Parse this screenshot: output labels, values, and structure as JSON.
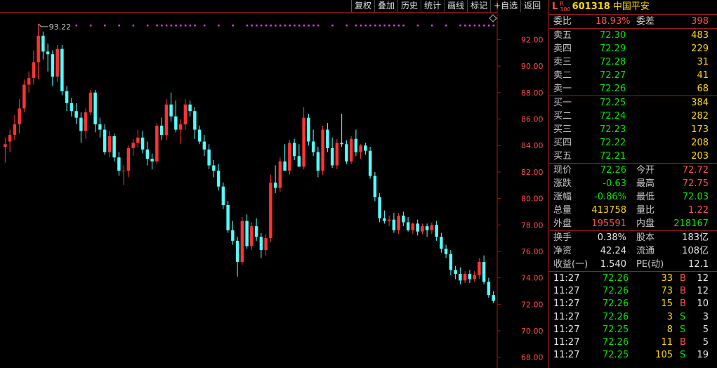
{
  "toolbar": [
    "复权",
    "叠加",
    "历史",
    "统计",
    "画线",
    "标记",
    "+自选",
    "返回"
  ],
  "header": {
    "prefix": "L",
    "r_top": "R",
    "r_bottom": "300",
    "code": "601318",
    "name": "中国平安"
  },
  "chart_data": {
    "type": "candlestick",
    "y_ticks": [
      "92.00",
      "90.00",
      "88.00",
      "86.00",
      "84.00",
      "82.00",
      "80.00",
      "78.00",
      "76.00",
      "74.00",
      "72.00",
      "70.00",
      "68.00"
    ],
    "ylim": [
      67.4,
      94.2
    ],
    "annotation": "93.22",
    "up_color": "#ff3333",
    "down_color": "#54ffff",
    "marker_color": "#ff33ff",
    "candles": [
      [
        83.9,
        84.6,
        82.7,
        84.1
      ],
      [
        84.3,
        85.2,
        83.5,
        84.8
      ],
      [
        84.8,
        86.3,
        84.4,
        85.6
      ],
      [
        85.6,
        87.5,
        84.9,
        86.8
      ],
      [
        86.8,
        89.0,
        86.5,
        88.6
      ],
      [
        88.6,
        89.6,
        88.0,
        89.1
      ],
      [
        89.1,
        91.2,
        88.6,
        90.3
      ],
      [
        90.3,
        93.2,
        89.0,
        92.3
      ],
      [
        92.3,
        92.6,
        90.5,
        91.1
      ],
      [
        91.1,
        91.7,
        89.6,
        90.9
      ],
      [
        90.9,
        91.2,
        88.5,
        89.2
      ],
      [
        89.2,
        91.6,
        88.8,
        91.3
      ],
      [
        91.3,
        91.6,
        87.8,
        88.1
      ],
      [
        88.1,
        88.5,
        86.6,
        87.2
      ],
      [
        87.2,
        87.6,
        86.2,
        86.6
      ],
      [
        86.6,
        87.2,
        85.6,
        86.1
      ],
      [
        86.1,
        86.5,
        84.2,
        85.1
      ],
      [
        85.1,
        86.8,
        84.5,
        86.5
      ],
      [
        86.5,
        88.2,
        86.3,
        88.0
      ],
      [
        88.0,
        88.2,
        85.0,
        85.6
      ],
      [
        85.6,
        86.1,
        84.6,
        85.2
      ],
      [
        85.2,
        85.6,
        83.3,
        83.5
      ],
      [
        83.5,
        85.1,
        83.1,
        84.7
      ],
      [
        84.7,
        84.9,
        82.8,
        83.1
      ],
      [
        83.1,
        83.5,
        81.7,
        82.1
      ],
      [
        82.1,
        82.5,
        81.0,
        82.1
      ],
      [
        82.1,
        84.0,
        81.6,
        83.8
      ],
      [
        83.8,
        84.5,
        83.2,
        84.2
      ],
      [
        84.2,
        85.2,
        83.8,
        84.6
      ],
      [
        84.6,
        85.1,
        83.4,
        83.7
      ],
      [
        83.7,
        84.3,
        82.5,
        83.0
      ],
      [
        83.0,
        83.4,
        82.2,
        82.8
      ],
      [
        82.8,
        85.7,
        82.6,
        85.5
      ],
      [
        85.5,
        86.1,
        84.4,
        84.8
      ],
      [
        84.8,
        87.5,
        84.4,
        87.1
      ],
      [
        87.1,
        88.0,
        85.8,
        86.2
      ],
      [
        86.2,
        87.4,
        85.0,
        85.2
      ],
      [
        85.2,
        86.0,
        84.1,
        85.6
      ],
      [
        85.6,
        87.5,
        85.2,
        87.1
      ],
      [
        87.1,
        87.4,
        86.2,
        86.6
      ],
      [
        86.6,
        86.9,
        84.5,
        85.2
      ],
      [
        85.2,
        85.5,
        84.1,
        84.3
      ],
      [
        84.3,
        84.8,
        83.2,
        83.7
      ],
      [
        83.7,
        84.1,
        82.2,
        82.5
      ],
      [
        82.5,
        82.9,
        81.6,
        82.1
      ],
      [
        82.1,
        82.6,
        80.6,
        80.9
      ],
      [
        80.9,
        81.2,
        79.2,
        79.5
      ],
      [
        79.5,
        79.8,
        77.4,
        77.6
      ],
      [
        77.6,
        78.3,
        76.5,
        76.8
      ],
      [
        76.8,
        77.1,
        74.1,
        75.2
      ],
      [
        75.2,
        78.6,
        75.0,
        78.3
      ],
      [
        78.3,
        78.8,
        76.2,
        76.4
      ],
      [
        76.4,
        78.2,
        76.1,
        77.9
      ],
      [
        77.9,
        78.5,
        76.8,
        77.1
      ],
      [
        77.1,
        77.4,
        75.5,
        76.1
      ],
      [
        76.1,
        77.3,
        75.7,
        77.0
      ],
      [
        77.0,
        81.8,
        76.7,
        81.2
      ],
      [
        81.2,
        82.5,
        80.4,
        80.8
      ],
      [
        80.8,
        83.1,
        80.5,
        82.8
      ],
      [
        82.8,
        84.1,
        82.5,
        82.1
      ],
      [
        82.1,
        84.4,
        81.8,
        84.2
      ],
      [
        84.2,
        84.5,
        82.9,
        83.2
      ],
      [
        83.2,
        84.1,
        82.6,
        82.4
      ],
      [
        82.4,
        86.9,
        82.2,
        86.1
      ],
      [
        86.1,
        86.4,
        84.0,
        84.3
      ],
      [
        84.3,
        85.2,
        83.2,
        83.5
      ],
      [
        83.5,
        83.9,
        81.6,
        82.1
      ],
      [
        82.1,
        85.5,
        81.8,
        85.2
      ],
      [
        85.2,
        85.7,
        83.5,
        83.8
      ],
      [
        83.8,
        84.6,
        82.3,
        82.5
      ],
      [
        82.5,
        84.5,
        82.2,
        84.2
      ],
      [
        84.2,
        86.4,
        83.9,
        84.1
      ],
      [
        84.1,
        84.4,
        82.6,
        82.8
      ],
      [
        82.8,
        84.7,
        82.6,
        84.5
      ],
      [
        84.5,
        85.2,
        83.2,
        83.5
      ],
      [
        83.5,
        84.1,
        83.0,
        84.0
      ],
      [
        84.0,
        84.2,
        83.3,
        83.6
      ],
      [
        83.6,
        83.9,
        81.5,
        81.7
      ],
      [
        81.7,
        82.0,
        79.8,
        80.1
      ],
      [
        80.1,
        80.4,
        78.2,
        78.5
      ],
      [
        78.5,
        79.1,
        78.1,
        78.3
      ],
      [
        78.3,
        78.7,
        77.9,
        78.4
      ],
      [
        78.4,
        78.9,
        77.4,
        77.6
      ],
      [
        77.6,
        78.9,
        77.3,
        78.7
      ],
      [
        78.7,
        79.0,
        77.9,
        78.2
      ],
      [
        78.2,
        78.6,
        77.5,
        77.6
      ],
      [
        77.6,
        78.2,
        77.3,
        78.1
      ],
      [
        78.1,
        78.4,
        77.2,
        77.5
      ],
      [
        77.5,
        78.1,
        77.3,
        77.9
      ],
      [
        77.9,
        78.1,
        77.1,
        77.6
      ],
      [
        77.6,
        78.2,
        77.3,
        78.0
      ],
      [
        78.0,
        78.3,
        76.8,
        77.1
      ],
      [
        77.1,
        77.4,
        75.9,
        76.2
      ],
      [
        76.2,
        76.5,
        75.5,
        75.8
      ],
      [
        75.8,
        76.1,
        74.2,
        74.6
      ],
      [
        74.6,
        74.9,
        73.9,
        74.3
      ],
      [
        74.3,
        74.8,
        73.5,
        73.8
      ],
      [
        73.8,
        74.5,
        73.6,
        74.3
      ],
      [
        74.3,
        74.6,
        73.6,
        73.9
      ],
      [
        73.9,
        74.5,
        73.7,
        74.2
      ],
      [
        74.2,
        75.5,
        73.9,
        75.2
      ],
      [
        75.2,
        75.7,
        73.5,
        73.7
      ],
      [
        73.7,
        74.0,
        72.5,
        72.7
      ],
      [
        72.7,
        73.0,
        72.1,
        72.26
      ]
    ]
  },
  "panel": {
    "weibi": {
      "label": "委比",
      "value": "18.93%",
      "label2": "委差",
      "value2": "398"
    },
    "sell": [
      {
        "label": "卖五",
        "price": "72.30",
        "vol": "483"
      },
      {
        "label": "卖四",
        "price": "72.29",
        "vol": "229"
      },
      {
        "label": "卖三",
        "price": "72.28",
        "vol": "31"
      },
      {
        "label": "卖二",
        "price": "72.27",
        "vol": "41"
      },
      {
        "label": "卖一",
        "price": "72.26",
        "vol": "68"
      }
    ],
    "buy": [
      {
        "label": "买一",
        "price": "72.25",
        "vol": "384"
      },
      {
        "label": "买二",
        "price": "72.24",
        "vol": "282"
      },
      {
        "label": "买三",
        "price": "72.23",
        "vol": "173"
      },
      {
        "label": "买四",
        "price": "72.22",
        "vol": "208"
      },
      {
        "label": "买五",
        "price": "72.21",
        "vol": "203"
      }
    ],
    "stats": [
      {
        "l1": "现价",
        "v1": "72.26",
        "c1": "grn",
        "l2": "今开",
        "v2": "72.72",
        "c2": "red"
      },
      {
        "l1": "涨跌",
        "v1": "-0.63",
        "c1": "grn",
        "l2": "最高",
        "v2": "72.75",
        "c2": "red"
      },
      {
        "l1": "涨幅",
        "v1": "-0.86%",
        "c1": "grn",
        "l2": "最低",
        "v2": "72.03",
        "c2": "grn"
      },
      {
        "l1": "总量",
        "v1": "413758",
        "c1": "yel",
        "l2": "量比",
        "v2": "1.22",
        "c2": "red"
      },
      {
        "l1": "外盘",
        "v1": "195591",
        "c1": "red",
        "l2": "内盘",
        "v2": "218167",
        "c2": "grn"
      }
    ],
    "fund": [
      {
        "l1": "换手",
        "v1": "0.38%",
        "l2": "股本",
        "v2": "183亿"
      },
      {
        "l1": "净资",
        "v1": "42.24",
        "l2": "流通",
        "v2": "108亿"
      },
      {
        "l1": "收益(一)",
        "v1": "1.540",
        "l2": "PE(动)",
        "v2": "12.1"
      }
    ],
    "ticks": [
      {
        "time": "11:27",
        "price": "72.26",
        "vol": "33",
        "bs": "B",
        "n": "12"
      },
      {
        "time": "11:27",
        "price": "72.26",
        "vol": "73",
        "bs": "B",
        "n": "12"
      },
      {
        "time": "11:27",
        "price": "72.26",
        "vol": "15",
        "bs": "B",
        "n": "10"
      },
      {
        "time": "11:27",
        "price": "72.26",
        "vol": "3",
        "bs": "S",
        "n": "3"
      },
      {
        "time": "11:27",
        "price": "72.25",
        "vol": "8",
        "bs": "S",
        "n": "5"
      },
      {
        "time": "11:27",
        "price": "72.26",
        "vol": "11",
        "bs": "B",
        "n": "5"
      },
      {
        "time": "11:27",
        "price": "72.25",
        "vol": "105",
        "bs": "S",
        "n": "19"
      }
    ]
  }
}
